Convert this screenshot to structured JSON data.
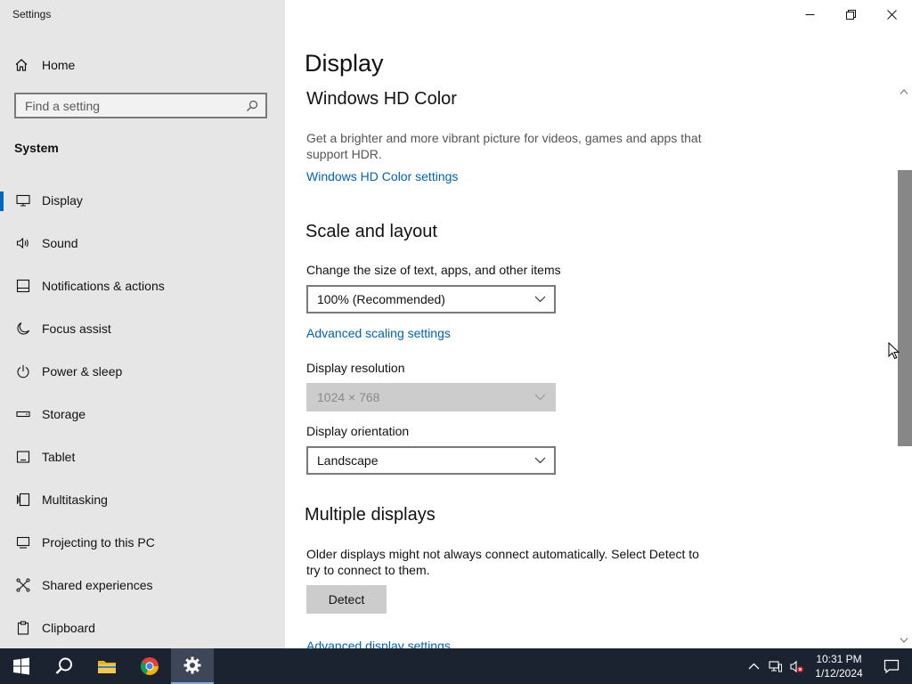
{
  "window": {
    "title": "Settings"
  },
  "sidebar": {
    "home_label": "Home",
    "search_placeholder": "Find a setting",
    "section_title": "System",
    "items": [
      {
        "label": "Display",
        "icon": "monitor-icon",
        "active": true
      },
      {
        "label": "Sound",
        "icon": "speaker-icon"
      },
      {
        "label": "Notifications & actions",
        "icon": "notification-icon"
      },
      {
        "label": "Focus assist",
        "icon": "moon-icon"
      },
      {
        "label": "Power & sleep",
        "icon": "power-icon"
      },
      {
        "label": "Storage",
        "icon": "storage-icon"
      },
      {
        "label": "Tablet",
        "icon": "tablet-icon"
      },
      {
        "label": "Multitasking",
        "icon": "multitasking-icon"
      },
      {
        "label": "Projecting to this PC",
        "icon": "projector-icon"
      },
      {
        "label": "Shared experiences",
        "icon": "shared-icon"
      },
      {
        "label": "Clipboard",
        "icon": "clipboard-icon"
      }
    ]
  },
  "main": {
    "page_title": "Display",
    "hdr": {
      "heading": "Windows HD Color",
      "description": "Get a brighter and more vibrant picture for videos, games and apps that support HDR.",
      "link": "Windows HD Color settings"
    },
    "scale": {
      "heading": "Scale and layout",
      "size_label": "Change the size of text, apps, and other items",
      "size_value": "100% (Recommended)",
      "advanced_link": "Advanced scaling settings",
      "resolution_label": "Display resolution",
      "resolution_value": "1024 × 768",
      "orientation_label": "Display orientation",
      "orientation_value": "Landscape"
    },
    "multiple": {
      "heading": "Multiple displays",
      "description": "Older displays might not always connect automatically. Select Detect to try to connect to them.",
      "detect_button": "Detect",
      "advanced_link": "Advanced display settings"
    }
  },
  "taskbar": {
    "apps": [
      "start-icon",
      "search-icon",
      "file-explorer-icon",
      "chrome-icon",
      "settings-icon"
    ],
    "clock_time": "10:31 PM",
    "clock_date": "1/12/2024"
  },
  "colors": {
    "accent": "#0067c0",
    "link": "#0063b1",
    "sidebar_bg": "#e6e6e6",
    "taskbar_bg": "#1c2330"
  }
}
